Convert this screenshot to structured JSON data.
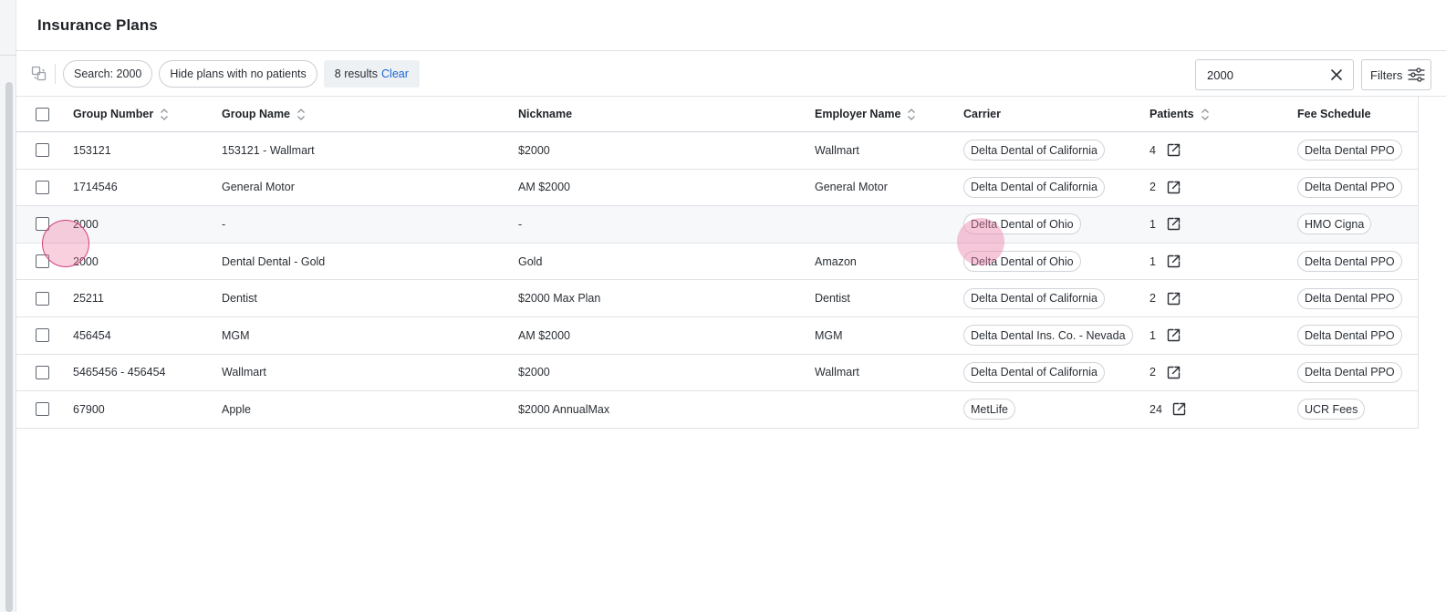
{
  "page": {
    "title": "Insurance Plans"
  },
  "toolbar": {
    "search_chip": "Search: 2000",
    "hide_chip": "Hide plans with no patients",
    "results_text": "8 results",
    "clear_label": "Clear",
    "search_value": "2000",
    "filters_label": "Filters"
  },
  "table": {
    "columns": [
      "Group Number",
      "Group Name",
      "Nickname",
      "Employer Name",
      "Carrier",
      "Patients",
      "Fee Schedule"
    ],
    "rows": [
      {
        "group_number": "153121",
        "group_name": "153121 - Wallmart",
        "nickname": "$2000",
        "employer": "Wallmart",
        "carrier": "Delta Dental of California",
        "patients": "4",
        "fee_schedule": "Delta Dental PPO"
      },
      {
        "group_number": "1714546",
        "group_name": "General Motor",
        "nickname": "AM $2000",
        "employer": "General Motor",
        "carrier": "Delta Dental of California",
        "patients": "2",
        "fee_schedule": "Delta Dental PPO"
      },
      {
        "group_number": "2000",
        "group_name": "-",
        "nickname": "-",
        "employer": "",
        "carrier": "Delta Dental of Ohio",
        "patients": "1",
        "fee_schedule": "HMO Cigna"
      },
      {
        "group_number": "2000",
        "group_name": "Dental Dental - Gold",
        "nickname": "Gold",
        "employer": "Amazon",
        "carrier": "Delta Dental of Ohio",
        "patients": "1",
        "fee_schedule": "Delta Dental PPO"
      },
      {
        "group_number": "25211",
        "group_name": "Dentist",
        "nickname": "$2000 Max Plan",
        "employer": "Dentist",
        "carrier": "Delta Dental of California",
        "patients": "2",
        "fee_schedule": "Delta Dental PPO"
      },
      {
        "group_number": "456454",
        "group_name": "MGM",
        "nickname": "AM $2000",
        "employer": "MGM",
        "carrier": "Delta Dental Ins. Co. - Nevada",
        "patients": "1",
        "fee_schedule": "Delta Dental PPO"
      },
      {
        "group_number": "5465456 - 456454",
        "group_name": "Wallmart",
        "nickname": "$2000",
        "employer": "Wallmart",
        "carrier": "Delta Dental of California",
        "patients": "2",
        "fee_schedule": "Delta Dental PPO"
      },
      {
        "group_number": "67900",
        "group_name": "Apple",
        "nickname": "$2000 AnnualMax",
        "employer": "",
        "carrier": "MetLife",
        "patients": "24",
        "fee_schedule": "UCR Fees"
      }
    ]
  },
  "icons": {
    "collapse": "collapse-panel-icon",
    "search_clear": "close-icon",
    "filters": "sliders-icon",
    "sort": "sort-icon",
    "external": "external-link-icon"
  },
  "colors": {
    "link": "#1a63d4",
    "border": "#dfe2e6",
    "touch": "#d23f7a"
  }
}
